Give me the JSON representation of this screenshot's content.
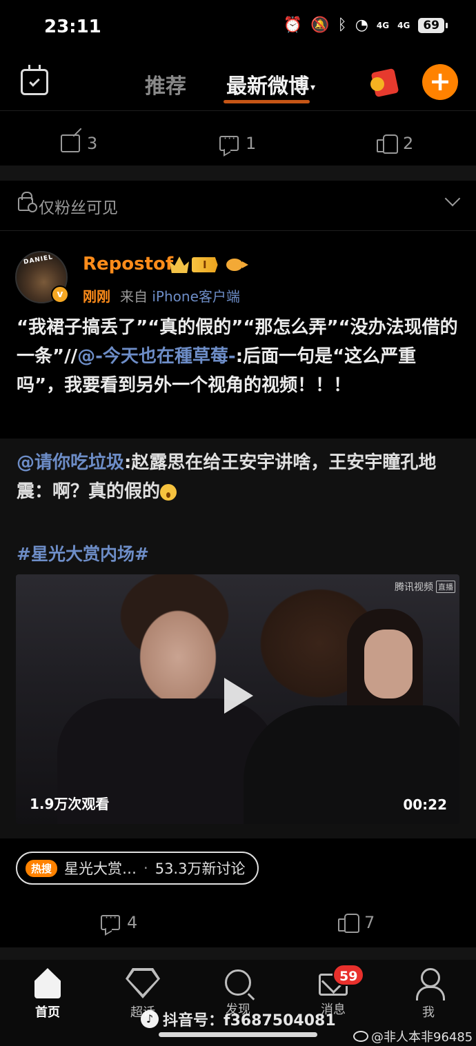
{
  "status_bar": {
    "time": "23:11",
    "net1": "4G",
    "net2": "4G",
    "battery": "69"
  },
  "header": {
    "tab_recommend": "推荐",
    "tab_latest": "最新微博"
  },
  "prev_post_actions": {
    "reposts": "3",
    "comments": "1",
    "likes": "2"
  },
  "visibility": {
    "label": "仅粉丝可见"
  },
  "post": {
    "username": "Repostof",
    "vip_level": "I",
    "time": "刚刚",
    "from_label": "来自",
    "source": "iPhone客户端",
    "text_part1": "“我裙子搞丢了”“真的假的”“那怎么弄”“没办法现借的一条”//",
    "mention": "@-今天也在種草莓-",
    "text_part2": ":后面一句是“这么严重吗”，我要看到另外一个视角的视频！！！"
  },
  "repost": {
    "mention": "@请你吃垃圾",
    "text": ":赵露思在给王安宇讲啥，王安宇瞳孔地震：啊？真的假的",
    "topic": "#星光大赏内场#",
    "video": {
      "watermark": "腾讯视频",
      "live": "直播",
      "views": "1.9万次观看",
      "duration": "00:22"
    }
  },
  "hot_search": {
    "tag": "热搜",
    "title": "星光大赏…",
    "separator": "·",
    "discussions": "53.3万新讨论"
  },
  "post_actions": {
    "comments": "4",
    "likes": "7"
  },
  "bottom_nav": {
    "home": "首页",
    "super": "超话",
    "discover": "发现",
    "messages": "消息",
    "me": "我",
    "message_badge": "59"
  },
  "overlay": {
    "douyin_text": "抖音号：f3687504081",
    "weibo_watermark": "@非人本非96485"
  },
  "colors": {
    "accent": "#ff8200",
    "link": "#6d8dc7",
    "username": "#ff8c1a",
    "badge": "#e8302c"
  }
}
